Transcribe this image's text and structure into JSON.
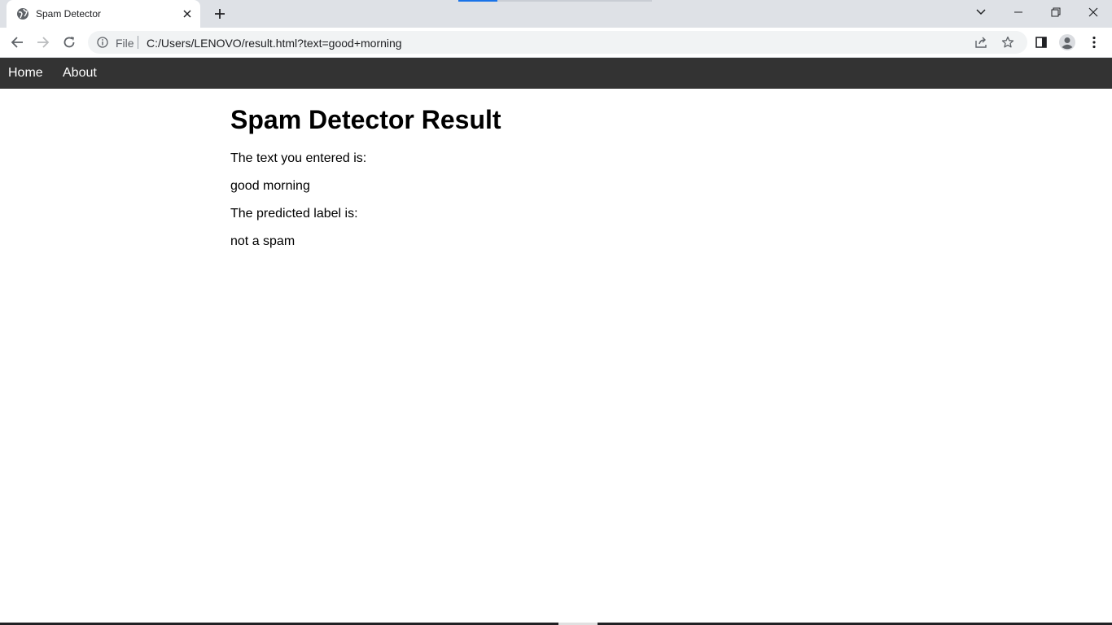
{
  "browser": {
    "tab": {
      "title": "Spam Detector",
      "favicon_icon": "globe-icon"
    },
    "address": {
      "scheme_label": "File",
      "url": "C:/Users/LENOVO/result.html?text=good+morning"
    }
  },
  "navbar": {
    "items": [
      {
        "label": "Home"
      },
      {
        "label": "About"
      }
    ]
  },
  "main": {
    "title": "Spam Detector Result",
    "entered_label": "The text you entered is:",
    "entered_text": "good morning",
    "predicted_label": "The predicted label is:",
    "predicted_value": "not a spam"
  },
  "colors": {
    "navbar_bg": "#333333",
    "tabstrip_bg": "#dee1e6",
    "accent": "#1a73e8"
  }
}
